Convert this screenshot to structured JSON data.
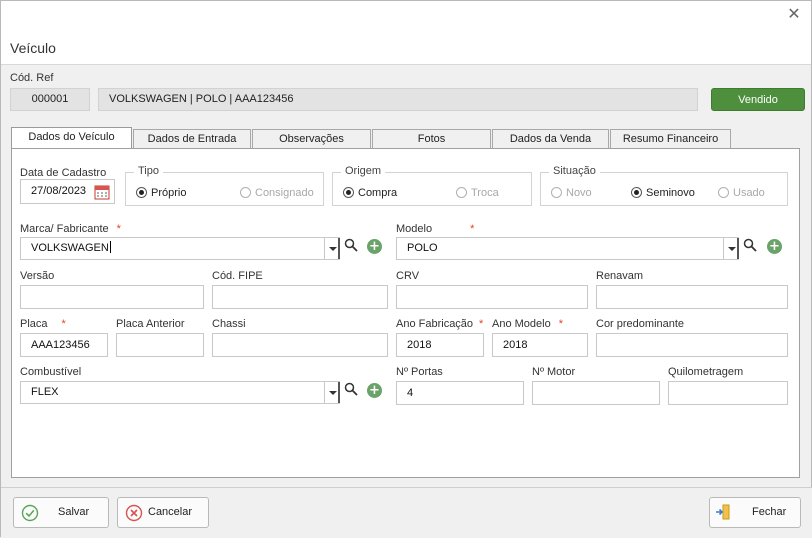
{
  "window": {
    "title": "Veículo",
    "close_glyph": "✕"
  },
  "reference": {
    "label": "Cód. Ref",
    "code": "000001",
    "description": "VOLKSWAGEN | POLO | AAA123456",
    "status": "Vendido",
    "status_color": "#4e8f3d"
  },
  "tabs": [
    {
      "label": "Dados do Veículo",
      "active": true
    },
    {
      "label": "Dados de Entrada",
      "active": false
    },
    {
      "label": "Observações",
      "active": false
    },
    {
      "label": "Fotos",
      "active": false
    },
    {
      "label": "Dados da Venda",
      "active": false
    },
    {
      "label": "Resumo Financeiro",
      "active": false
    }
  ],
  "form": {
    "data_cadastro": {
      "label": "Data de Cadastro",
      "value": "27/08/2023",
      "icon": "calendar-icon"
    },
    "tipo": {
      "label": "Tipo",
      "options": [
        "Próprio",
        "Consignado"
      ],
      "selected": "Próprio"
    },
    "origem": {
      "label": "Origem",
      "options": [
        "Compra",
        "Troca"
      ],
      "selected": "Compra"
    },
    "situacao": {
      "label": "Situação",
      "options": [
        "Novo",
        "Seminovo",
        "Usado"
      ],
      "selected": "Seminovo"
    },
    "marca": {
      "label": "Marca/ Fabricante",
      "required": "*",
      "value": "VOLKSWAGEN"
    },
    "modelo": {
      "label": "Modelo",
      "required": "*",
      "value": "POLO"
    },
    "versao": {
      "label": "Versão",
      "value": ""
    },
    "cod_fipe": {
      "label": "Cód. FIPE",
      "value": ""
    },
    "crv": {
      "label": "CRV",
      "value": ""
    },
    "renavam": {
      "label": "Renavam",
      "value": ""
    },
    "placa": {
      "label": "Placa",
      "required": "*",
      "value": "AAA123456"
    },
    "placa_anterior": {
      "label": "Placa Anterior",
      "value": ""
    },
    "chassi": {
      "label": "Chassi",
      "value": ""
    },
    "ano_fabricacao": {
      "label": "Ano Fabricação",
      "required": "*",
      "value": "2018"
    },
    "ano_modelo": {
      "label": "Ano Modelo",
      "required": "*",
      "value": "2018"
    },
    "cor": {
      "label": "Cor predominante",
      "value": ""
    },
    "combustivel": {
      "label": "Combustível",
      "value": "FLEX"
    },
    "portas": {
      "label": "Nº Portas",
      "value": "4"
    },
    "motor": {
      "label": "Nº Motor",
      "value": ""
    },
    "quilometragem": {
      "label": "Quilometragem",
      "value": ""
    }
  },
  "footer": {
    "save": "Salvar",
    "cancel": "Cancelar",
    "close": "Fechar"
  },
  "colors": {
    "accent_green": "#6aa36a",
    "required_mark": "#e0451b",
    "cancel_red": "#d9534f"
  }
}
